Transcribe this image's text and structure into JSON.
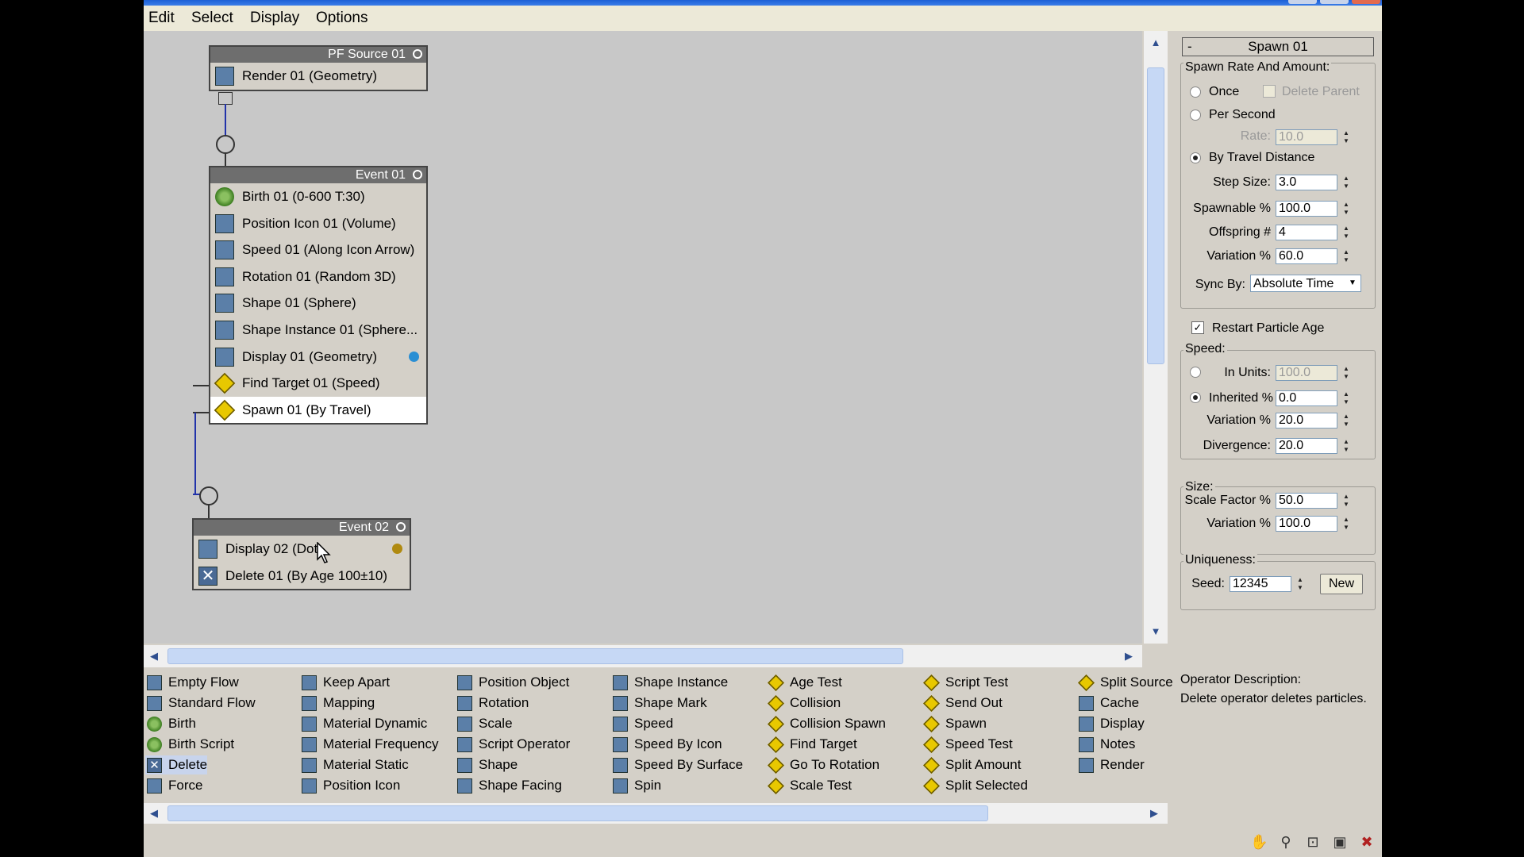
{
  "menu": [
    "Edit",
    "Select",
    "Display",
    "Options"
  ],
  "events": {
    "pf_source": {
      "title": "PF Source 01",
      "ops": [
        "Render 01 (Geometry)"
      ]
    },
    "event01": {
      "title": "Event 01",
      "ops": [
        "Birth 01 (0-600 T:30)",
        "Position Icon 01 (Volume)",
        "Speed 01 (Along Icon Arrow)",
        "Rotation 01 (Random 3D)",
        "Shape 01 (Sphere)",
        "Shape Instance 01 (Sphere...",
        "Display 01 (Geometry)",
        "Find Target 01 (Speed)",
        "Spawn 01 (By Travel)"
      ]
    },
    "event02": {
      "title": "Event 02",
      "ops": [
        "Display 02 (Dot",
        "Delete 01 (By Age 100±10)"
      ]
    }
  },
  "colors": {
    "display01_dot": "#2a8fd4",
    "display02_dot": "#b08a10",
    "titlebar": "#1c5fd6"
  },
  "panel": {
    "rollout_title": "Spawn 01",
    "rollout_toggle": "-",
    "spawn_group": "Spawn Rate And Amount:",
    "once": "Once",
    "delete_parent": "Delete Parent",
    "per_second": "Per Second",
    "rate_label": "Rate:",
    "rate_value": "10.0",
    "by_travel": "By Travel Distance",
    "step_size_label": "Step Size:",
    "step_size": "3.0",
    "spawnable_label": "Spawnable %",
    "spawnable": "100.0",
    "offspring_label": "Offspring #",
    "offspring": "4",
    "variation_label": "Variation %",
    "variation": "60.0",
    "sync_label": "Sync By:",
    "sync_value": "Absolute Time",
    "restart_age": "Restart Particle Age",
    "speed_group": "Speed:",
    "in_units_label": "In Units:",
    "in_units": "100.0",
    "inherited_label": "Inherited %",
    "inherited": "0.0",
    "speed_var_label": "Variation %",
    "speed_var": "20.0",
    "divergence_label": "Divergence:",
    "divergence": "20.0",
    "size_group": "Size:",
    "scale_label": "Scale Factor %",
    "scale": "50.0",
    "size_var_label": "Variation %",
    "size_var": "100.0",
    "uniq_group": "Uniqueness:",
    "seed_label": "Seed:",
    "seed": "12345",
    "new_btn": "New"
  },
  "depot": {
    "col1": [
      "Empty Flow",
      "Standard Flow",
      "Birth",
      "Birth Script",
      "Delete",
      "Force"
    ],
    "col2": [
      "Keep Apart",
      "Mapping",
      "Material Dynamic",
      "Material Frequency",
      "Material Static",
      "Position Icon"
    ],
    "col3": [
      "Position Object",
      "Rotation",
      "Scale",
      "Script Operator",
      "Shape",
      "Shape Facing"
    ],
    "col4": [
      "Shape Instance",
      "Shape Mark",
      "Speed",
      "Speed By Icon",
      "Speed By Surface",
      "Spin"
    ],
    "col5": [
      "Age Test",
      "Collision",
      "Collision Spawn",
      "Find Target",
      "Go To Rotation",
      "Scale Test"
    ],
    "col6": [
      "Script Test",
      "Send Out",
      "Spawn",
      "Speed Test",
      "Split Amount",
      "Split Selected"
    ],
    "col7": [
      "Split Source",
      "Cache",
      "Display",
      "Notes",
      "Render"
    ]
  },
  "description": {
    "label": "Operator Description:",
    "text": "Delete operator deletes particles."
  },
  "scroll_arrows": {
    "up": "▲",
    "down": "▼",
    "left": "◀",
    "right": "▶"
  }
}
